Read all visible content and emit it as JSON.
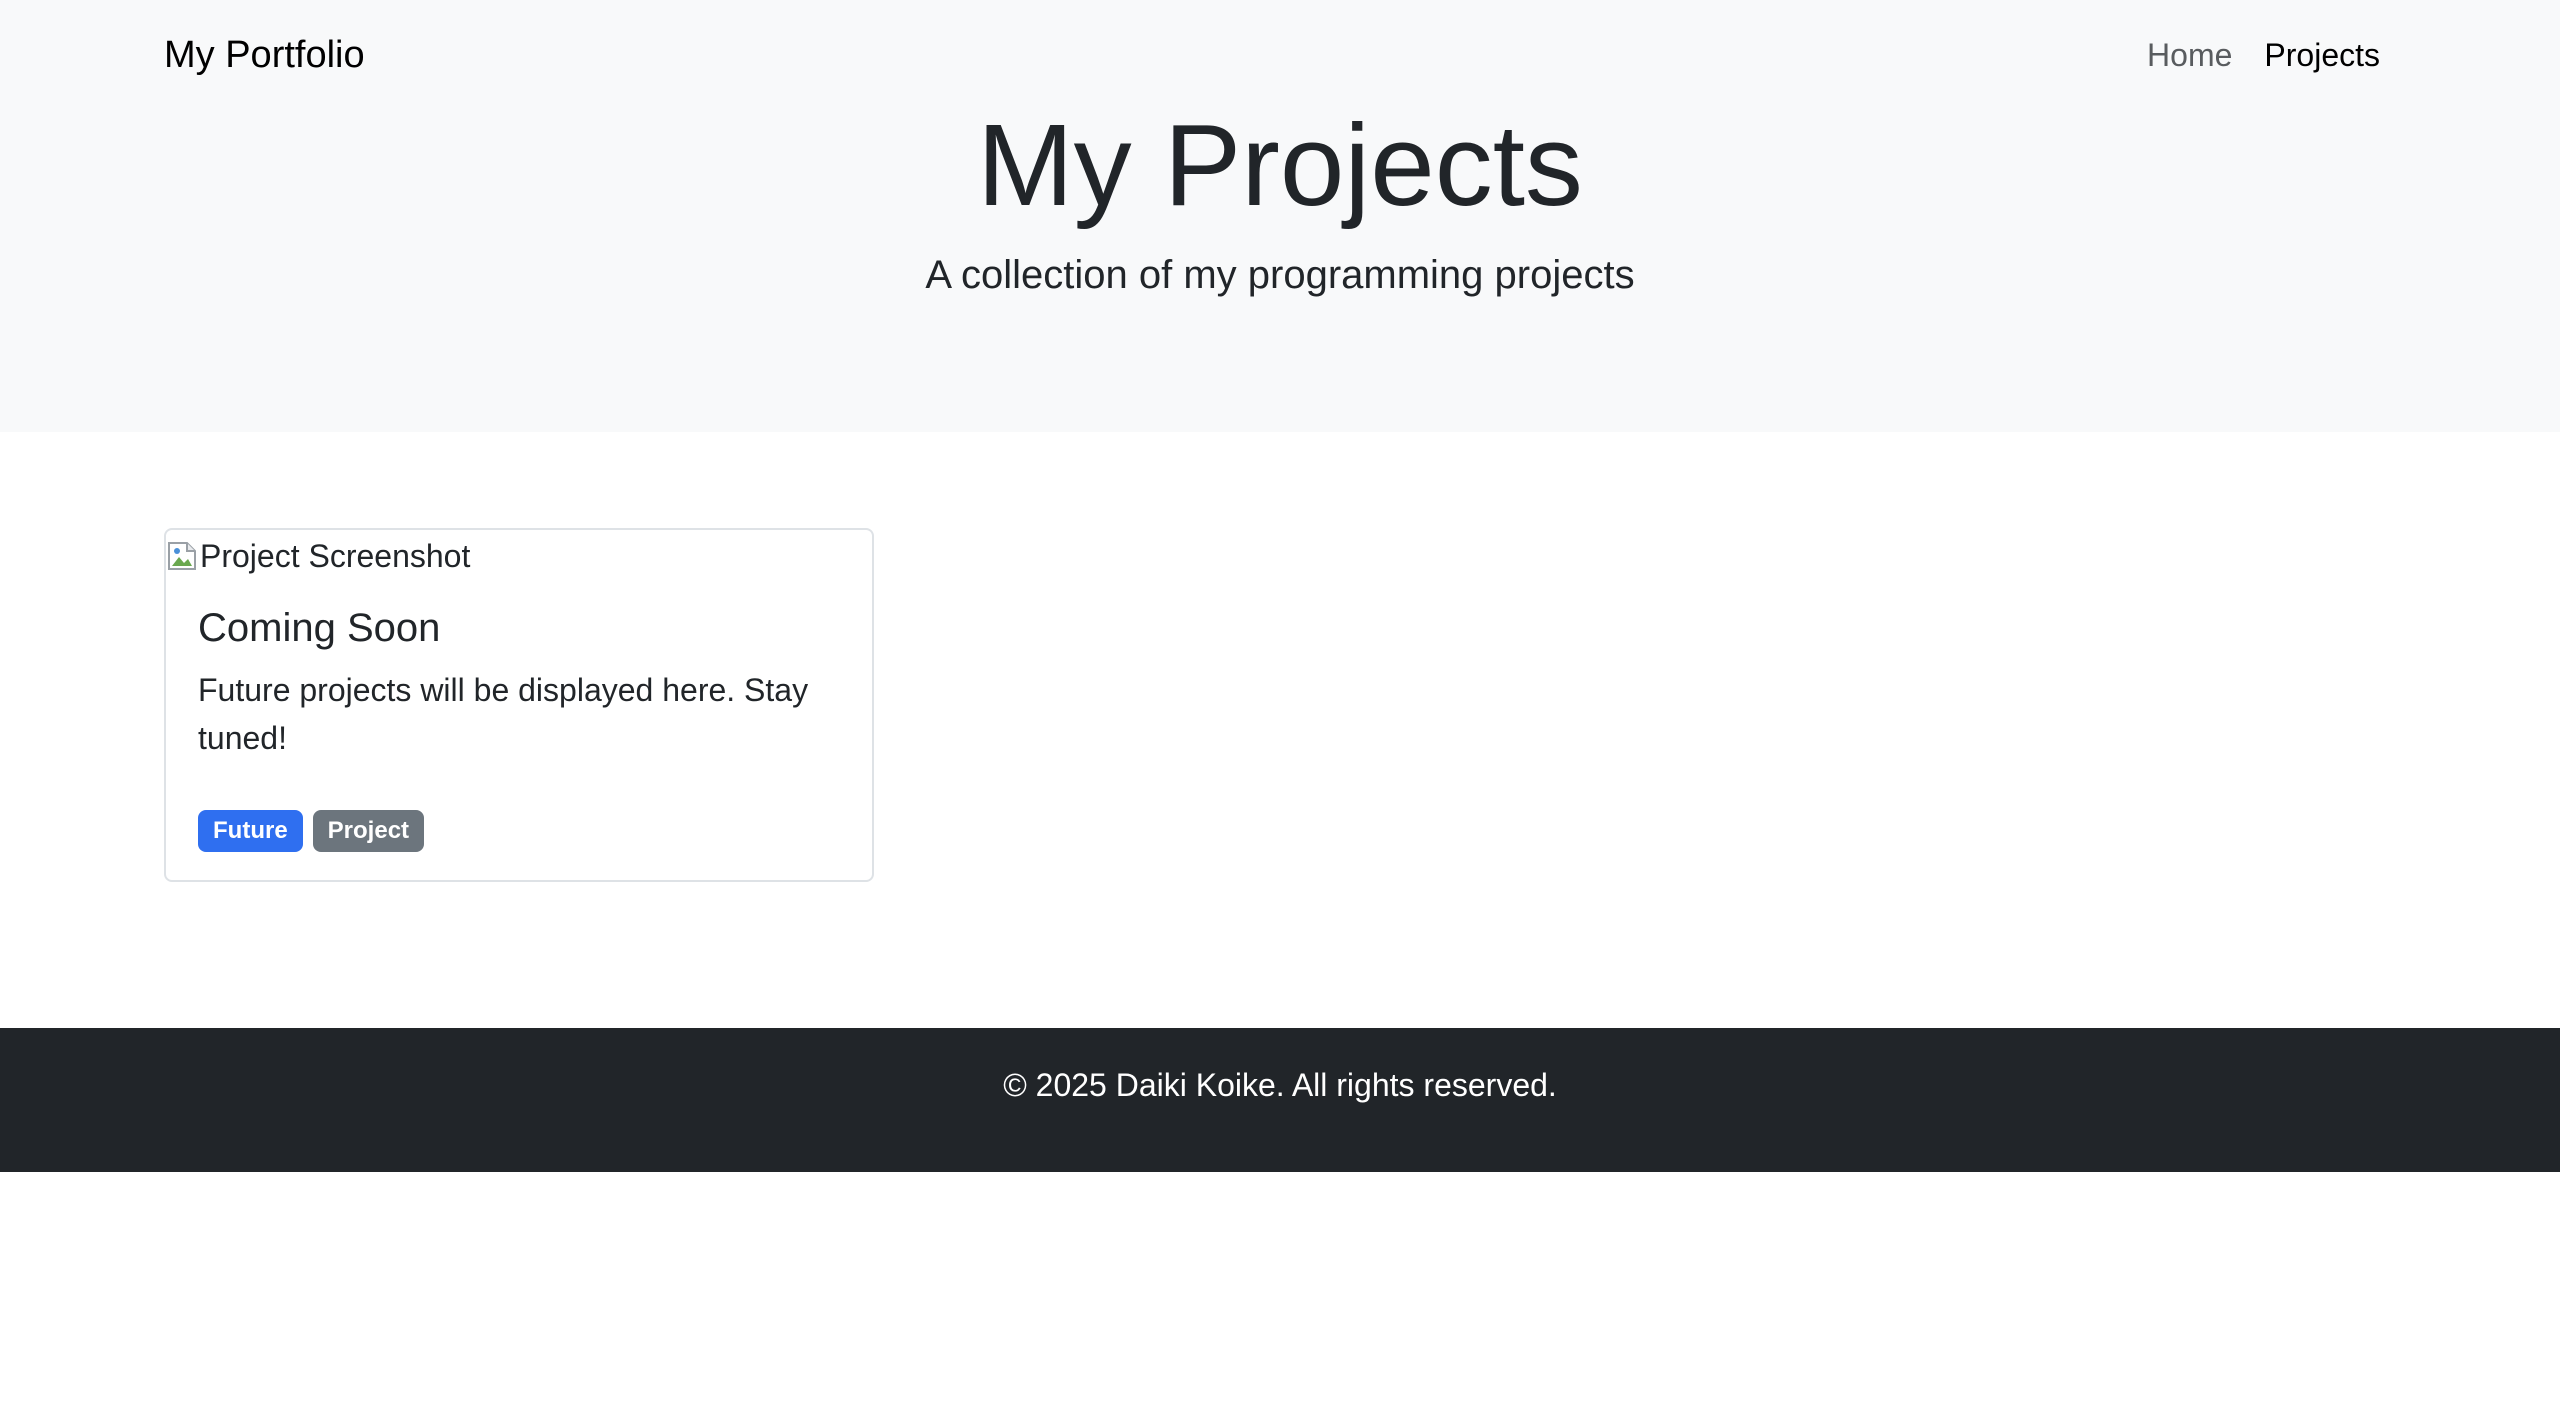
{
  "navbar": {
    "brand": "My Portfolio",
    "links": [
      {
        "label": "Home"
      },
      {
        "label": "Projects"
      }
    ]
  },
  "hero": {
    "title": "My Projects",
    "subtitle": "A collection of my programming projects"
  },
  "projects": [
    {
      "image_alt": "Project Screenshot",
      "title": "Coming Soon",
      "description": "Future projects will be displayed here. Stay tuned!",
      "badges": [
        {
          "label": "Future",
          "color": "#2f6ff0"
        },
        {
          "label": "Project",
          "color": "#6c757d"
        }
      ]
    }
  ],
  "footer": {
    "text": "© 2025 Daiki Koike. All rights reserved."
  }
}
